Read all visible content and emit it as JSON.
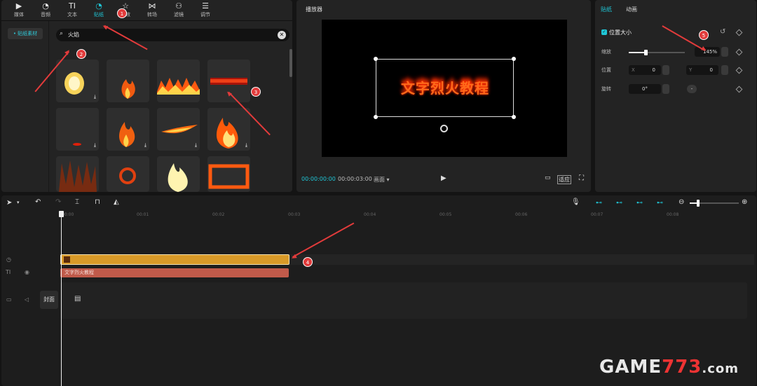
{
  "toolbar": {
    "items": [
      {
        "label": "媒体",
        "icon": "media-icon"
      },
      {
        "label": "音频",
        "icon": "audio-icon"
      },
      {
        "label": "文本",
        "icon": "text-icon"
      },
      {
        "label": "贴纸",
        "icon": "sticker-icon"
      },
      {
        "label": "特效",
        "icon": "effects-icon"
      },
      {
        "label": "转场",
        "icon": "transition-icon"
      },
      {
        "label": "滤镜",
        "icon": "filter-icon"
      },
      {
        "label": "调节",
        "icon": "adjust-icon"
      }
    ],
    "active": "贴纸"
  },
  "sidebar": {
    "chip_label": "• 贴纸素材"
  },
  "search": {
    "value": "火焰"
  },
  "stickers": {
    "count_visible": 12
  },
  "player": {
    "title": "播放器",
    "preview_text": "文字烈火教程",
    "current_time": "00:00:00:00",
    "total_time": "00:00:03:00",
    "ratio_label": "画面",
    "fit_label": "适应"
  },
  "props": {
    "tabs": [
      "贴纸",
      "动画"
    ],
    "section_title": "位置大小",
    "scale_label": "缩放",
    "scale_value": "145%",
    "scale_fraction": 0.3,
    "position_label": "位置",
    "x_label": "X",
    "x_value": "0",
    "y_label": "Y",
    "y_value": "0",
    "rotate_label": "旋转",
    "rotate_value": "0°"
  },
  "timeline": {
    "ruler": [
      "00:00",
      "00:01",
      "00:02",
      "00:03",
      "00:04",
      "00:05",
      "00:06",
      "00:07",
      "00:08"
    ],
    "text_clip_label": "文字烈火教程",
    "cover_label": "封面"
  },
  "annotations": [
    "1",
    "2",
    "3",
    "4",
    "5"
  ],
  "watermark": {
    "main": "GAME",
    "digits": "773",
    "suffix": ".com"
  },
  "colors": {
    "accent": "#1fc6d6",
    "marker": "#e23b3b",
    "sticker_clip": "#d99a28",
    "text_clip": "#c05a4a"
  }
}
